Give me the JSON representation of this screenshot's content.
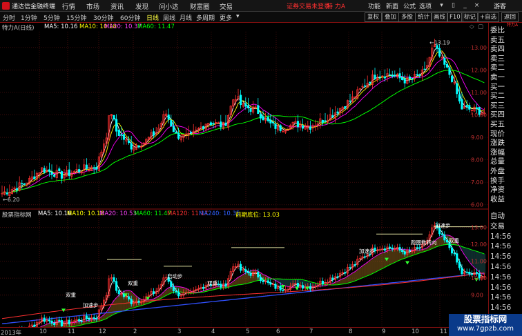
{
  "topbar": {
    "app_title": "通达信金融终端",
    "menus": [
      "行情",
      "市场",
      "资讯",
      "发现",
      "问小达",
      "财富圈",
      "交易"
    ],
    "alert": "证券交易未登录",
    "stock_name": "特 力A",
    "right_menus": [
      "功能",
      "新面",
      "公式",
      "选项"
    ],
    "guest": "游客"
  },
  "periodbar": {
    "periods": [
      "分时",
      "1分钟",
      "5分钟",
      "15分钟",
      "30分钟",
      "60分钟",
      "日线",
      "周线",
      "月线",
      "多周期",
      "更多"
    ],
    "active": "日线",
    "tools": [
      "复权",
      "叠加",
      "多股",
      "统计",
      "画线",
      "F10",
      "标记",
      "+自选",
      "返回"
    ]
  },
  "main_legend": {
    "name": "特力A(日线)",
    "ma5": "MA5: 10.16",
    "ma10": "MA10: 10.18",
    "ma20": "MA20: 10.37",
    "ma60": "MA60: 11.47"
  },
  "main_axis": [
    "13.00",
    "12.00",
    "11.00",
    "10.00",
    "9.00",
    "8.00",
    "7.00",
    "6.00"
  ],
  "price_labels": {
    "high": "13.19",
    "low": "6.20"
  },
  "ind_legend": {
    "name": "股票指标网",
    "ma5": "MA5: 10.16",
    "ma10": "MA10: 10.18",
    "ma20": "MA20: 10.53",
    "ma60": "MA60: 11.47",
    "ma120": "MA120: 11.17",
    "ma240": "MA240: 10.35",
    "prev_low": "前期底位: 13.03"
  },
  "ind_axis": [
    "13.00",
    "12.00",
    "11.00",
    "10.00",
    "9.00"
  ],
  "annotations": [
    "加速步",
    "双重",
    "双重",
    "启动步",
    "加速步",
    "跑圈数转向",
    "双重",
    "加速步",
    "双重"
  ],
  "sidebar": {
    "top": "特力A",
    "items": [
      "委比",
      "卖五",
      "卖四",
      "卖三",
      "卖二",
      "卖一",
      "买一",
      "买二",
      "买三",
      "买四",
      "买五",
      "现价",
      "涨跌",
      "涨幅",
      "总量",
      "外盘",
      "换手",
      "净资",
      "收益"
    ],
    "lower": [
      "自动",
      "交易",
      "14:56",
      "14:56",
      "14:56",
      "14:56",
      "14:56",
      "14:56",
      "14:56",
      "14:56"
    ]
  },
  "x_axis": [
    "2013年",
    "10",
    "11",
    "12",
    "2",
    "3",
    "4",
    "5",
    "6",
    "7",
    "8",
    "9",
    "10",
    "11",
    "12"
  ],
  "watermark": {
    "line1": "股票指标网",
    "line2": "www.7gpzb.com"
  },
  "colors": {
    "up": "#ff3030",
    "down": "#00ffff",
    "ma5": "#ffffff",
    "ma10": "#ffff00",
    "ma20": "#ff00ff",
    "ma60": "#00ff00",
    "ma240": "#3050ff"
  }
}
